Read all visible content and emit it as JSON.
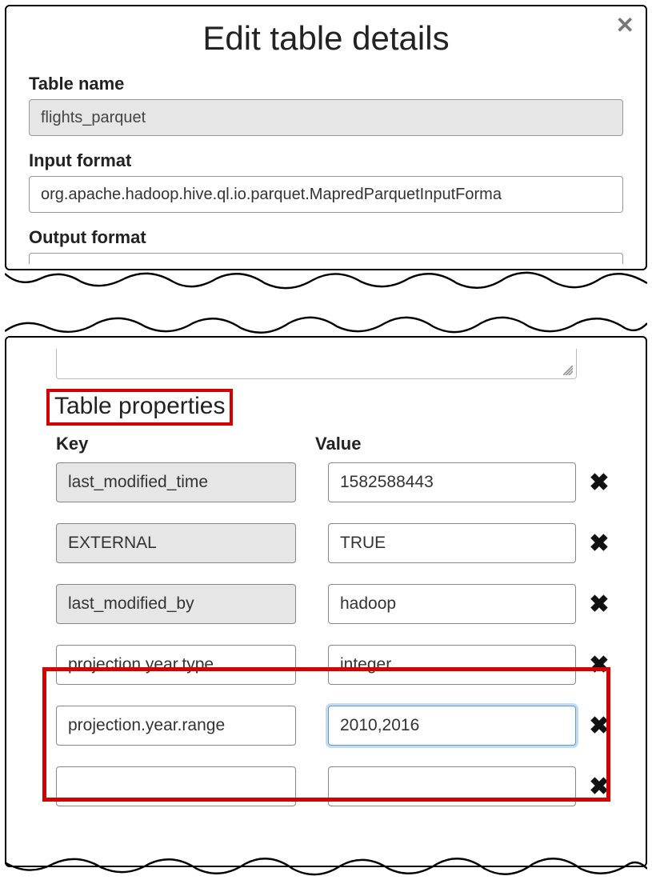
{
  "modal": {
    "title": "Edit table details",
    "close_icon": "✕"
  },
  "fields": {
    "table_name_label": "Table name",
    "table_name_value": "flights_parquet",
    "input_format_label": "Input format",
    "input_format_value": "org.apache.hadoop.hive.ql.io.parquet.MapredParquetInputForma",
    "output_format_label": "Output format"
  },
  "table_properties": {
    "section_title": "Table properties",
    "header_key": "Key",
    "header_value": "Value",
    "rows": [
      {
        "key": "last_modified_time",
        "value": "1582588443",
        "locked": true
      },
      {
        "key": "EXTERNAL",
        "value": "TRUE",
        "locked": true
      },
      {
        "key": "last_modified_by",
        "value": "hadoop",
        "locked": true
      },
      {
        "key": "projection.year.type",
        "value": "integer",
        "locked": false
      },
      {
        "key": "projection.year.range",
        "value": "2010,2016",
        "locked": false,
        "focused": true
      },
      {
        "key": "",
        "value": "",
        "locked": false
      }
    ]
  },
  "icons": {
    "delete": "✖"
  }
}
